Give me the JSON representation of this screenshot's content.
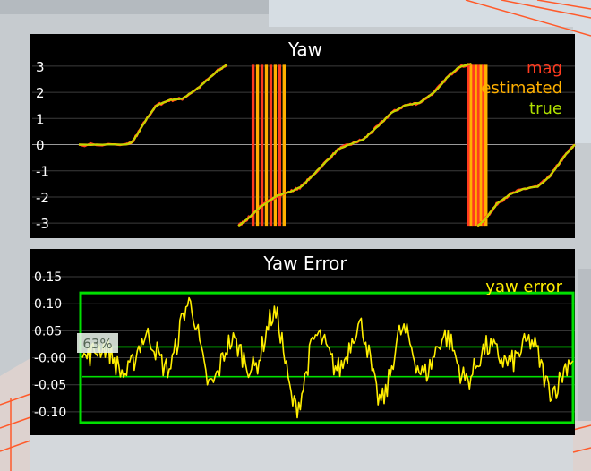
{
  "chart_data": [
    {
      "type": "line",
      "title": "Yaw",
      "xlabel": "",
      "ylabel": "",
      "ylim": [
        -3.2,
        3.2
      ],
      "yticks": [
        "3",
        "2",
        "1",
        "0",
        "-1",
        "-2",
        "-3"
      ],
      "grid": true,
      "legend_position": "top-right",
      "series": [
        {
          "name": "mag",
          "color": "#ff3b1f",
          "x": [
            0,
            0.55,
            0.62,
            0.68,
            0.78,
            0.9,
            1.05,
            1.2,
            1.4,
            1.6,
            1.72,
            1.85,
            1.95,
            2.1,
            2.3,
            2.45,
            2.58,
            2.72,
            2.88,
            3.02,
            3.18,
            3.3,
            3.45,
            3.62,
            3.78,
            3.95,
            4.12,
            4.28,
            4.4,
            4.55,
            4.62,
            4.7,
            4.78,
            4.85,
            5.0,
            5.15,
            5.32,
            5.45,
            5.55,
            5.65,
            5.75
          ],
          "y": [
            0,
            0,
            0.1,
            0.4,
            0.95,
            1.5,
            1.7,
            1.75,
            2.2,
            2.8,
            3.05,
            -3.1,
            -2.85,
            -2.4,
            -1.95,
            -1.8,
            -1.6,
            -1.15,
            -0.6,
            -0.15,
            0.05,
            0.2,
            0.65,
            1.2,
            1.5,
            1.6,
            2.0,
            2.6,
            2.95,
            3.1,
            -3.1,
            -2.9,
            -2.55,
            -2.25,
            -1.9,
            -1.7,
            -1.6,
            -1.25,
            -0.8,
            -0.35,
            0
          ]
        },
        {
          "name": "estimated",
          "color": "#ffb000",
          "x": [
            0,
            0.55,
            0.62,
            0.68,
            0.78,
            0.9,
            1.05,
            1.2,
            1.4,
            1.6,
            1.72,
            1.85,
            1.95,
            2.1,
            2.3,
            2.45,
            2.58,
            2.72,
            2.88,
            3.02,
            3.18,
            3.3,
            3.45,
            3.62,
            3.78,
            3.95,
            4.12,
            4.28,
            4.4,
            4.55,
            4.62,
            4.7,
            4.78,
            4.85,
            5.0,
            5.15,
            5.32,
            5.45,
            5.55,
            5.65,
            5.75
          ],
          "y": [
            0,
            0,
            0.1,
            0.4,
            0.95,
            1.5,
            1.7,
            1.75,
            2.2,
            2.8,
            3.05,
            -3.1,
            -2.85,
            -2.4,
            -1.95,
            -1.8,
            -1.6,
            -1.15,
            -0.6,
            -0.15,
            0.05,
            0.2,
            0.65,
            1.2,
            1.5,
            1.6,
            2.0,
            2.6,
            2.95,
            3.1,
            -3.1,
            -2.9,
            -2.55,
            -2.25,
            -1.9,
            -1.7,
            -1.6,
            -1.25,
            -0.8,
            -0.35,
            0
          ]
        },
        {
          "name": "true",
          "color": "#b0e000",
          "x": [
            0,
            0.55,
            0.62,
            0.68,
            0.78,
            0.9,
            1.05,
            1.2,
            1.4,
            1.6,
            1.72,
            1.85,
            1.95,
            2.1,
            2.3,
            2.45,
            2.58,
            2.72,
            2.88,
            3.02,
            3.18,
            3.3,
            3.45,
            3.62,
            3.78,
            3.95,
            4.12,
            4.28,
            4.4,
            4.55,
            4.62,
            4.7,
            4.78,
            4.85,
            5.0,
            5.15,
            5.32,
            5.45,
            5.55,
            5.65,
            5.75
          ],
          "y": [
            0,
            0,
            0.1,
            0.4,
            0.95,
            1.5,
            1.7,
            1.75,
            2.2,
            2.8,
            3.05,
            -3.1,
            -2.85,
            -2.4,
            -1.95,
            -1.8,
            -1.6,
            -1.15,
            -0.6,
            -0.15,
            0.05,
            0.2,
            0.65,
            1.2,
            1.5,
            1.6,
            2.0,
            2.6,
            2.95,
            3.1,
            -3.1,
            -2.9,
            -2.55,
            -2.25,
            -1.9,
            -1.7,
            -1.6,
            -1.25,
            -0.8,
            -0.35,
            0
          ]
        }
      ]
    },
    {
      "type": "line",
      "title": "Yaw Error",
      "xlabel": "",
      "ylabel": "",
      "ylim": [
        -0.13,
        0.16
      ],
      "yticks": [
        "0.15",
        "0.10",
        "0.05",
        "-0.00",
        "-0.05",
        "-0.10"
      ],
      "grid": true,
      "legend_position": "top-right",
      "threshold_box": {
        "ymin": -0.12,
        "ymax": 0.12,
        "color": "#00e000"
      },
      "threshold_lines": [
        0.02,
        -0.035
      ],
      "badge_text": "63%",
      "series": [
        {
          "name": "yaw error",
          "color": "#ffee00",
          "x": [
            0,
            0.25,
            0.5,
            0.75,
            1.0,
            1.25,
            1.5,
            1.75,
            2.0,
            2.25,
            2.5,
            2.75,
            3.0,
            3.25,
            3.5,
            3.75,
            4.0,
            4.25,
            4.5,
            4.75,
            5.0,
            5.25,
            5.5,
            5.75
          ],
          "y": [
            0.0,
            0.02,
            -0.03,
            0.04,
            -0.02,
            0.1,
            -0.05,
            0.03,
            -0.02,
            0.08,
            -0.09,
            0.04,
            -0.02,
            0.06,
            -0.08,
            0.05,
            -0.03,
            0.04,
            -0.04,
            0.02,
            -0.01,
            0.03,
            -0.06,
            0.0
          ]
        }
      ]
    }
  ]
}
